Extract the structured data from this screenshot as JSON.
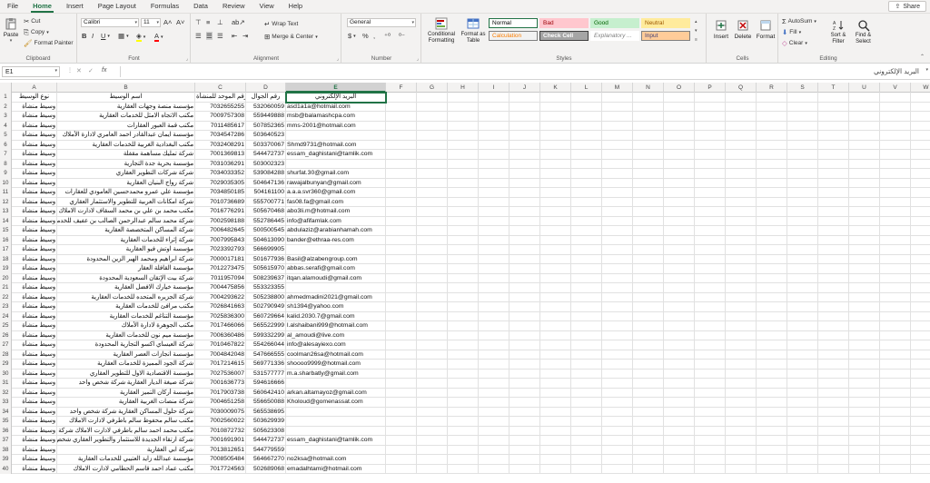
{
  "menu": {
    "tabs": [
      "File",
      "Home",
      "Insert",
      "Page Layout",
      "Formulas",
      "Data",
      "Review",
      "View",
      "Help"
    ],
    "active": "Home",
    "share_label": "Share"
  },
  "ribbon": {
    "clipboard": {
      "paste": "Paste",
      "cut": "Cut",
      "copy": "Copy",
      "format_painter": "Format Painter",
      "label": "Clipboard"
    },
    "font": {
      "name": "Calibri",
      "size": "11",
      "label": "Font"
    },
    "alignment": {
      "wrap_text": "Wrap Text",
      "merge_center": "Merge & Center",
      "label": "Alignment"
    },
    "number": {
      "format": "General",
      "label": "Number"
    },
    "styles": {
      "conditional_formatting": "Conditional Formatting",
      "format_as_table": "Format as Table",
      "cells": [
        {
          "label": "Normal",
          "bg": "#ffffff",
          "fg": "#000000",
          "border": "#217346"
        },
        {
          "label": "Bad",
          "bg": "#ffc7ce",
          "fg": "#9c0006",
          "border": "#ffc7ce"
        },
        {
          "label": "Good",
          "bg": "#c6efce",
          "fg": "#006100",
          "border": "#c6efce"
        },
        {
          "label": "Neutral",
          "bg": "#ffeb9c",
          "fg": "#9c5700",
          "border": "#ffeb9c"
        },
        {
          "label": "Calculation",
          "bg": "#f2f2f2",
          "fg": "#fa7d00",
          "border": "#7f7f7f"
        },
        {
          "label": "Check Cell",
          "bg": "#a5a5a5",
          "fg": "#ffffff",
          "border": "#3f3f3f"
        },
        {
          "label": "Explanatory ...",
          "bg": "#ffffff",
          "fg": "#7f7f7f",
          "border": "#ffffff"
        },
        {
          "label": "Input",
          "bg": "#ffcc99",
          "fg": "#3f3f76",
          "border": "#7f7f7f"
        }
      ],
      "label": "Styles"
    },
    "cells": {
      "insert": "Insert",
      "delete": "Delete",
      "format": "Format",
      "label": "Cells"
    },
    "editing": {
      "autosum": "AutoSum",
      "fill": "Fill",
      "clear": "Clear",
      "sort_filter": "Sort & Filter",
      "find_select": "Find & Select",
      "label": "Editing"
    }
  },
  "formula_bar": {
    "name_box": "E1",
    "fx": "fx",
    "content": "البريد الإلكتروني"
  },
  "columns": [
    "A",
    "B",
    "C",
    "D",
    "E",
    "F",
    "G",
    "H",
    "I",
    "J",
    "K",
    "L",
    "M",
    "N",
    "O",
    "P",
    "Q",
    "R",
    "S",
    "T",
    "U",
    "V",
    "W"
  ],
  "selected_column": "E",
  "headers": {
    "A": "نوع الوسيط",
    "B": "اسم الوسيط",
    "C": "الرقم الموحد للمنشأة",
    "D": "رقم الجوال",
    "E": "البريد الإلكتروني"
  },
  "rows": [
    {
      "a": "وسيط منشأة",
      "b": "مؤسسة منصة وجهات العقارية",
      "c": "7032655255",
      "d": "532060059",
      "e": "asd1a1a@hotmail.com"
    },
    {
      "a": "وسيط منشأة",
      "b": "مكتب الاتجاه الامثل للخدمات العقارية",
      "c": "7009757308",
      "d": "559449888",
      "e": "msb@balamashcpa.com"
    },
    {
      "a": "وسيط منشأة",
      "b": "مكتب قمة العبور العقارات",
      "c": "7011485617",
      "d": "507852365",
      "e": "mms-2001@hotmail.com"
    },
    {
      "a": "وسيط منشأة",
      "b": "مؤسسة ايمان عبدالقادر احمد العامري لادارة الأملاك",
      "c": "7034547286",
      "d": "503640523",
      "e": ""
    },
    {
      "a": "وسيط منشأة",
      "b": "مكتب البغدادية الغربية للخدمات العقارية",
      "c": "7032408291",
      "d": "503370067",
      "e": "Shmd9731@hotmail.com"
    },
    {
      "a": "وسيط منشأة",
      "b": "شركة تمليك مساهمة مقفلة",
      "c": "7001369813",
      "d": "544472737",
      "e": "essam_daghistani@tamlik.com"
    },
    {
      "a": "وسيط منشأة",
      "b": "مؤسسة بحرية جدة التجارية",
      "c": "7031036291",
      "d": "503002323",
      "e": ""
    },
    {
      "a": "وسيط منشأة",
      "b": "شركة شركات التطوير العقاري",
      "c": "7034033352",
      "d": "539084288",
      "e": "shurfat.30@gmail.com"
    },
    {
      "a": "وسيط منشأة",
      "b": "شركة رواج البنيان العقارية",
      "c": "7029035305",
      "d": "504647136",
      "e": "rawajalbunyan@gmail.com"
    },
    {
      "a": "وسيط منشأة",
      "b": "مؤسسة علي عمرو محمدحسين العامودي للعقارات",
      "c": "7034850185",
      "d": "504161100",
      "e": "a.a.a.svr360@gmail.com"
    },
    {
      "a": "وسيط منشأة",
      "b": "شركة امكانات العربية للتطوير والاستثمار العقاري",
      "c": "7010736689",
      "d": "555700771",
      "e": "fas08.fa@gmail.com"
    },
    {
      "a": "وسيط منشأة",
      "b": "مكتب محمد بن علي بن محمد السقاف لادارت الاملاك",
      "c": "7016776291",
      "d": "505670468",
      "e": "abo3li.m@hotmail.com"
    },
    {
      "a": "وسيط منشأة",
      "b": "شركة محمد سالم عبدالرحمن الصالب بن عفيف للخدمات",
      "c": "7002598188",
      "d": "552786445",
      "e": "info@afifamlak.com"
    },
    {
      "a": "وسيط منشأة",
      "b": "شركة المساكن المتخصصة العقارية",
      "c": "7006482645",
      "d": "500500545",
      "e": "abdulaziz@arabianhamah.com"
    },
    {
      "a": "وسيط منشأة",
      "b": "شركة إثراء للخدمات العقارية",
      "c": "7007995843",
      "d": "504613090",
      "e": "bander@ethraa-res.com"
    },
    {
      "a": "وسيط منشأة",
      "b": "مؤسسة اوتش فيو العقارية",
      "c": "7023392793",
      "d": "566699905",
      "e": ""
    },
    {
      "a": "وسيط منشأة",
      "b": "شركة ابراهيم ومحمد الهبر الزين المحدودة",
      "c": "7000017181",
      "d": "501677936",
      "e": "Basil@alzabengroup.com"
    },
    {
      "a": "وسيط منشأة",
      "b": "مؤسسة القافلة العقار",
      "c": "7012273475",
      "d": "505615970",
      "e": "abbas.serafi@gmail.com"
    },
    {
      "a": "وسيط منشأة",
      "b": "شركة بيت الإتقان السعودية المحدودة",
      "c": "7011957094",
      "d": "508239637",
      "e": "itqan.alamoudi@gmail.com"
    },
    {
      "a": "وسيط منشأة",
      "b": "مؤسسة خيارك الافضل العقارية",
      "c": "7004475856",
      "d": "553323355",
      "e": ""
    },
    {
      "a": "وسيط منشأة",
      "b": "شركة الجزيره المتحده للخدمات العقارية",
      "c": "7004293622",
      "d": "505238800",
      "e": "ahmedmadini2021@gmail.com"
    },
    {
      "a": "وسيط منشأة",
      "b": "مكتب مرافئ للخدمات العقارية",
      "c": "7026841663",
      "d": "502790949",
      "e": "sh1394@yahoo.com"
    },
    {
      "a": "وسيط منشأة",
      "b": "مؤسسة التناغم للخدمات العقارية",
      "c": "7025836300",
      "d": "560729664",
      "e": "kalid.2030.7@gmail.com"
    },
    {
      "a": "وسيط منشأة",
      "b": "مكتب الجوهرة لادارة الأملاك",
      "c": "7017466066",
      "d": "565522999",
      "e": "l.alshaibani999@hotmail.com"
    },
    {
      "a": "وسيط منشأة",
      "b": "مؤسسة ميم نون للخدمات العقارية",
      "c": "7006360486",
      "d": "599332299",
      "e": "al_amoudi@live.com"
    },
    {
      "a": "وسيط منشأة",
      "b": "شركة العيساي اكسو التجارية المحدودة",
      "c": "7010467822",
      "d": "554266044",
      "e": "info@alesayiexo.com"
    },
    {
      "a": "وسيط منشأة",
      "b": "مؤسسة انجازات العصر العقارية",
      "c": "7004842048",
      "d": "547666555",
      "e": "coolman26sa@hotmail.com"
    },
    {
      "a": "وسيط منشأة",
      "b": "شركة الجود المميزة للخدمات العقارية",
      "c": "7017214615",
      "d": "569771336",
      "e": "shoooo9999@hotmail.com"
    },
    {
      "a": "وسيط منشأة",
      "b": "مؤسسة الاقتصادية الاول للتطوير العقاري",
      "c": "7027536007",
      "d": "531577777",
      "e": "m.a.sharbatly@gmail.com"
    },
    {
      "a": "وسيط منشأة",
      "b": "شركة صيغة الديار العقارية شركة شخص واحد",
      "c": "7001636773",
      "d": "594616666",
      "e": ""
    },
    {
      "a": "وسيط منشأة",
      "b": "مؤسسة أركان التميز العقارية",
      "c": "7017903738",
      "d": "560642410",
      "e": "arkan.altamayoz@gmail.com"
    },
    {
      "a": "وسيط منشأة",
      "b": "شركة منصات الغربية العقارية",
      "c": "7004651258",
      "d": "556650088",
      "e": "Kholoud@gomenassat.com"
    },
    {
      "a": "وسيط منشأة",
      "b": "شركة حلول المساكن العقارية شركة شخص واحد",
      "c": "7030009075",
      "d": "565538695",
      "e": ""
    },
    {
      "a": "وسيط منشأة",
      "b": "مكتب سالم محفوظ سالم باطرفي لادارت الاملاك",
      "c": "7002560022",
      "d": "503629939",
      "e": ""
    },
    {
      "a": "وسيط منشأة",
      "b": "مكتب محمد احمد سالم باطرفي لادارت الاملاك شركة شخص وسيط منشأة",
      "c": "7010872732",
      "d": "505623308",
      "e": ""
    },
    {
      "a": "وسيط منشأة",
      "b": "شركة ارتقاء الجديدة للاستثمار والتطوير العقاري شخص واحد وسيط منشأة",
      "c": "7001691901",
      "d": "544472737",
      "e": "essam_daghistani@tamlik.com"
    },
    {
      "a": "وسيط منشأة",
      "b": "شركة ابي العقارية",
      "c": "7013812651",
      "d": "544779559",
      "e": ""
    },
    {
      "a": "وسيط منشأة",
      "b": "مؤسسة عبدالله زايد العتيبي للخدمات العقارية",
      "c": "7008505484",
      "d": "564667270",
      "e": "no2ksa@hotmail.com"
    },
    {
      "a": "وسيط منشأة",
      "b": "مكتب عماد احمد قاسم الحطامي لادارت الاملاك",
      "c": "7017724563",
      "d": "502689068",
      "e": "emadalhtami@hotmail.com"
    }
  ]
}
